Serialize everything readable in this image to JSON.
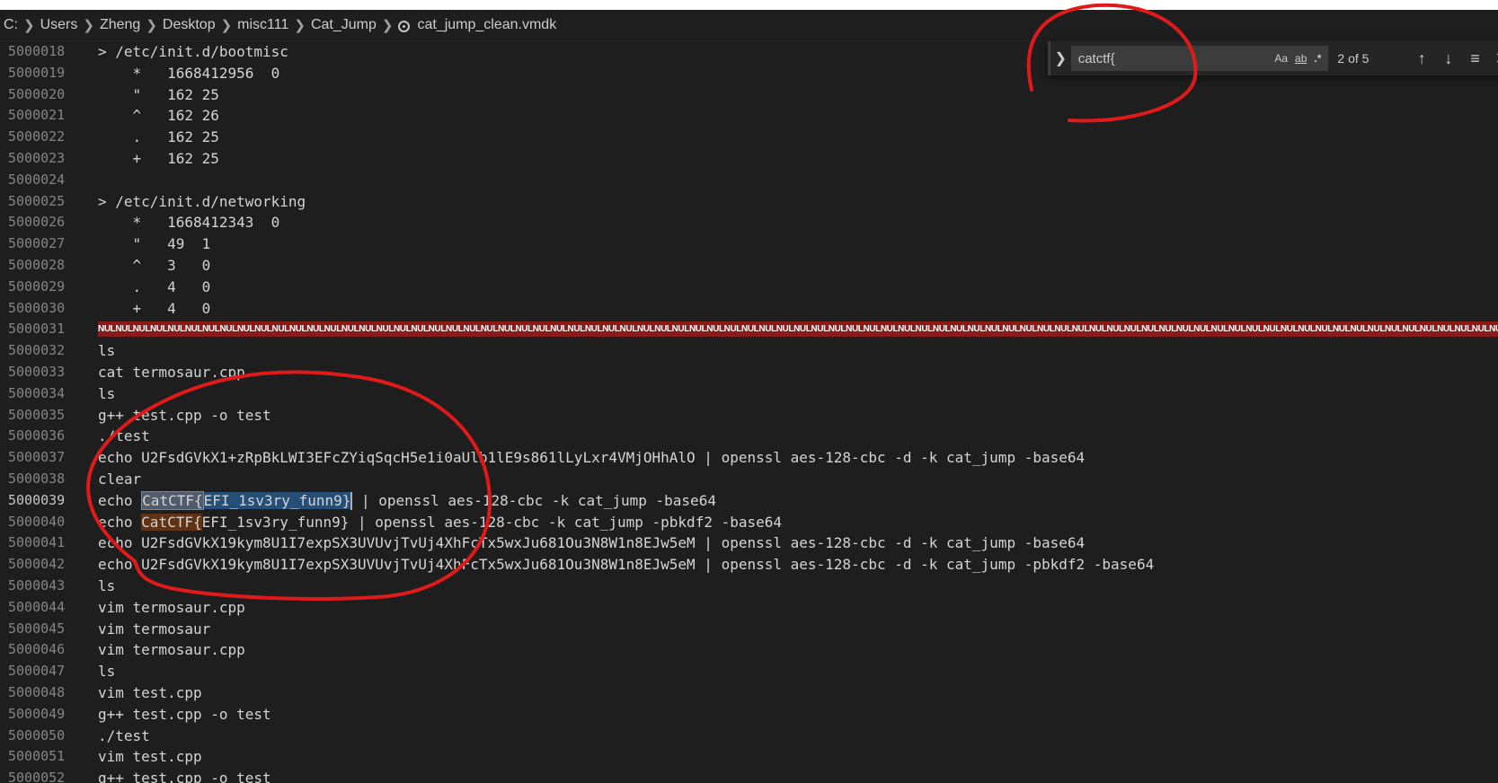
{
  "breadcrumb": {
    "items": [
      "C:",
      "Users",
      "Zheng",
      "Desktop",
      "misc111",
      "Cat_Jump"
    ],
    "file": "cat_jump_clean.vmdk"
  },
  "find": {
    "query": "catctf{",
    "match_case_label": "Aa",
    "whole_word_label": "ab",
    "regex_label": ".*",
    "count": "2 of 5"
  },
  "lines": [
    {
      "n": "5000018",
      "text": "> /etc/init.d/bootmisc"
    },
    {
      "n": "5000019",
      "text": "    *   1668412956  0"
    },
    {
      "n": "5000020",
      "text": "    \"   162 25"
    },
    {
      "n": "5000021",
      "text": "    ^   162 26"
    },
    {
      "n": "5000022",
      "text": "    .   162 25"
    },
    {
      "n": "5000023",
      "text": "    +   162 25"
    },
    {
      "n": "5000024",
      "text": ""
    },
    {
      "n": "5000025",
      "text": "> /etc/init.d/networking"
    },
    {
      "n": "5000026",
      "text": "    *   1668412343  0"
    },
    {
      "n": "5000027",
      "text": "    \"   49  1"
    },
    {
      "n": "5000028",
      "text": "    ^   3   0"
    },
    {
      "n": "5000029",
      "text": "    .   4   0"
    },
    {
      "n": "5000030",
      "text": "    +   4   0"
    },
    {
      "n": "5000031",
      "text": "",
      "nul": "NULNULNULNULNULNULNULNULNULNULNULNULNULNULNULNULNULNULNULNULNULNULNULNULNULNULNULNULNULNULNULNULNULNULNULNULNULNULNULNULNULNULNULNULNULNULNULNULNULNULNULNULNULNULNULNULNULNULNULNULNULNULNULNULNULNULNULNULNULNULNULNULNULNULNULNULNULNULNULNULNULNULNULNULNULNULNULNULNULNULNULNULNULNULNULNULNULNULNULNULNULNULNULNULNULNULNULNULNULNULNULNULNULNULNULNULNULNULNULNUL"
    },
    {
      "n": "5000032",
      "text": "ls"
    },
    {
      "n": "5000033",
      "text": "cat termosaur.cpp"
    },
    {
      "n": "5000034",
      "text": "ls"
    },
    {
      "n": "5000035",
      "text": "g++ test.cpp -o test"
    },
    {
      "n": "5000036",
      "text": "./test"
    },
    {
      "n": "5000037",
      "text": "echo U2FsdGVkX1+zRpBkLWI3EFcZYiqSqcH5e1i0aUlb1lE9s861lLyLxr4VMjOHhAlO | openssl aes-128-cbc -d -k cat_jump -base64"
    },
    {
      "n": "5000038",
      "text": "clear"
    },
    {
      "n": "5000039",
      "pre": "echo ",
      "match": "CatCTF{",
      "post_sel": "EFI_1sv3ry_funn9}",
      "rest": " | openssl aes-128-cbc -k cat_jump -base64",
      "current": true
    },
    {
      "n": "5000040",
      "pre": "echo ",
      "match": "CatCTF{",
      "post_sel": "EFI_1sv3ry_funn9}",
      "rest": " | openssl aes-128-cbc -k cat_jump -pbkdf2 -base64"
    },
    {
      "n": "5000041",
      "text": "echo U2FsdGVkX19kym8U1I7expSX3UVUvjTvUj4XhFcTx5wxJu681Ou3N8W1n8EJw5eM | openssl aes-128-cbc -d -k cat_jump -base64"
    },
    {
      "n": "5000042",
      "text": "echo U2FsdGVkX19kym8U1I7expSX3UVUvjTvUj4XhFcTx5wxJu681Ou3N8W1n8EJw5eM | openssl aes-128-cbc -d -k cat_jump -pbkdf2 -base64"
    },
    {
      "n": "5000043",
      "text": "ls"
    },
    {
      "n": "5000044",
      "text": "vim termosaur.cpp"
    },
    {
      "n": "5000045",
      "text": "vim termosaur"
    },
    {
      "n": "5000046",
      "text": "vim termosaur.cpp"
    },
    {
      "n": "5000047",
      "text": "ls"
    },
    {
      "n": "5000048",
      "text": "vim test.cpp"
    },
    {
      "n": "5000049",
      "text": "g++ test.cpp -o test"
    },
    {
      "n": "5000050",
      "text": "./test"
    },
    {
      "n": "5000051",
      "text": "vim test.cpp"
    },
    {
      "n": "5000052",
      "text": "g++ test.cpp -o test"
    }
  ],
  "colors": {
    "annotation": "#e01a1a",
    "match_highlight": "#613214",
    "current_match": "#515c6a",
    "nul_bar": "#8b1a1a"
  }
}
